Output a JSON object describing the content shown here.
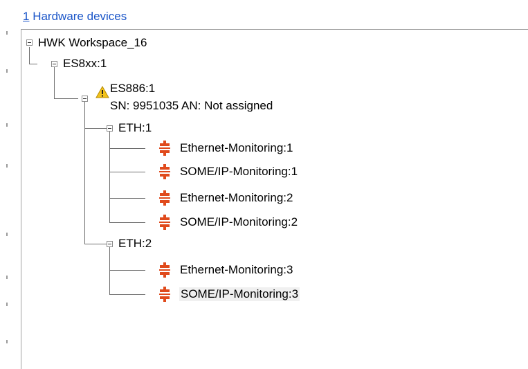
{
  "panel": {
    "accelerator": "1",
    "title_rest": " Hardware devices"
  },
  "tree": {
    "workspace": "HWK Workspace_16",
    "es8xx": "ES8xx:1",
    "es886": "ES886:1",
    "es886_info": "SN: 9951035 AN: Not assigned",
    "eth1": "ETH:1",
    "eth1_children": [
      "Ethernet-Monitoring:1",
      "SOME/IP-Monitoring:1",
      "Ethernet-Monitoring:2",
      "SOME/IP-Monitoring:2"
    ],
    "eth2": "ETH:2",
    "eth2_children": [
      "Ethernet-Monitoring:3",
      "SOME/IP-Monitoring:3"
    ]
  },
  "icons": {
    "expander": "collapse-icon",
    "warning": "warning-icon",
    "monitoring": "monitoring-device-icon"
  },
  "colors": {
    "link": "#1a55c8",
    "device_icon": "#e04a1c",
    "warning": "#f2c21b",
    "selection": "#f0f0f0"
  }
}
